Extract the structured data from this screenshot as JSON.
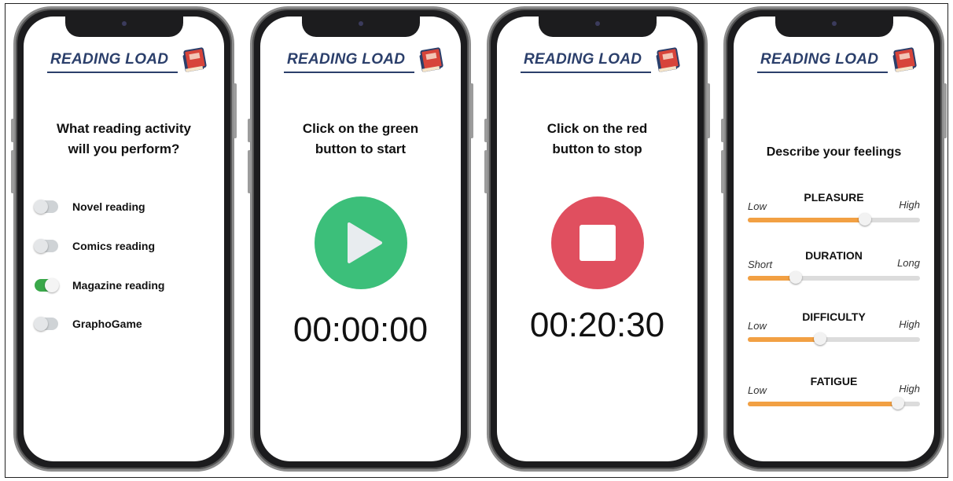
{
  "app": {
    "title": "READING LOAD"
  },
  "colors": {
    "accent_green": "#3cbf7a",
    "accent_red": "#e04f5f",
    "slider_fill": "#f2a043",
    "logo_text": "#2b3f6b"
  },
  "screen1": {
    "question_line1": "What reading activity",
    "question_line2": "will you perform?",
    "options": [
      {
        "label": "Novel reading",
        "on": false
      },
      {
        "label": "Comics reading",
        "on": false
      },
      {
        "label": "Magazine reading",
        "on": true
      },
      {
        "label": "GraphoGame",
        "on": false
      }
    ]
  },
  "screen2": {
    "instruction_line1": "Click on the green",
    "instruction_line2": "button to start",
    "button_icon": "play-icon",
    "timer": "00:00:00"
  },
  "screen3": {
    "instruction_line1": "Click on the red",
    "instruction_line2": "button to stop",
    "button_icon": "stop-icon",
    "timer": "00:20:30"
  },
  "screen4": {
    "title": "Describe your feelings",
    "sliders": [
      {
        "name": "PLEASURE",
        "low": "Low",
        "high": "High",
        "value": 0.68
      },
      {
        "name": "DURATION",
        "low": "Short",
        "high": "Long",
        "value": 0.28
      },
      {
        "name": "DIFFICULTY",
        "low": "Low",
        "high": "High",
        "value": 0.42
      },
      {
        "name": "FATIGUE",
        "low": "Low",
        "high": "High",
        "value": 0.87
      }
    ]
  }
}
